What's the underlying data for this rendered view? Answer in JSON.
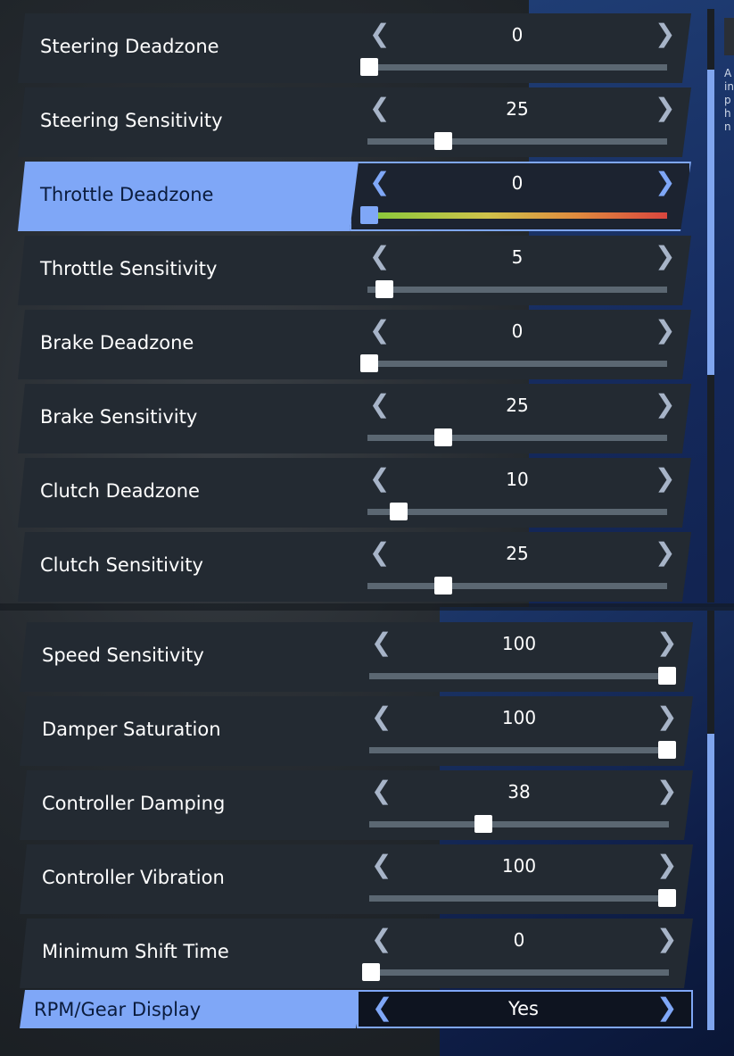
{
  "settings_top": [
    {
      "label": "Steering Deadzone",
      "value": "0",
      "level": 0
    },
    {
      "label": "Steering Sensitivity",
      "value": "25",
      "level": 0.25
    },
    {
      "label": "Throttle Deadzone",
      "value": "0",
      "level": 0,
      "active": true
    },
    {
      "label": "Throttle Sensitivity",
      "value": "5",
      "level": 0.05
    },
    {
      "label": "Brake Deadzone",
      "value": "0",
      "level": 0
    },
    {
      "label": "Brake Sensitivity",
      "value": "25",
      "level": 0.25
    },
    {
      "label": "Clutch Deadzone",
      "value": "10",
      "level": 0.1
    },
    {
      "label": "Clutch Sensitivity",
      "value": "25",
      "level": 0.25
    }
  ],
  "settings_bottom": [
    {
      "label": "Speed Sensitivity",
      "value": "100",
      "level": 1.0
    },
    {
      "label": "Damper Saturation",
      "value": "100",
      "level": 1.0
    },
    {
      "label": "Controller Damping",
      "value": "38",
      "level": 0.38
    },
    {
      "label": "Controller Vibration",
      "value": "100",
      "level": 1.0
    },
    {
      "label": "Minimum Shift Time",
      "value": "0",
      "level": 0
    }
  ],
  "rpm_gear": {
    "label": "RPM/Gear Display",
    "value": "Yes"
  },
  "arrows": {
    "left": "❮",
    "right": "❯"
  },
  "side_panel_text": [
    "A",
    "in",
    "p",
    "h",
    "n"
  ],
  "colors": {
    "accent": "#7fa7f7",
    "row_bg": "#232a32",
    "track": "#5b6772"
  }
}
